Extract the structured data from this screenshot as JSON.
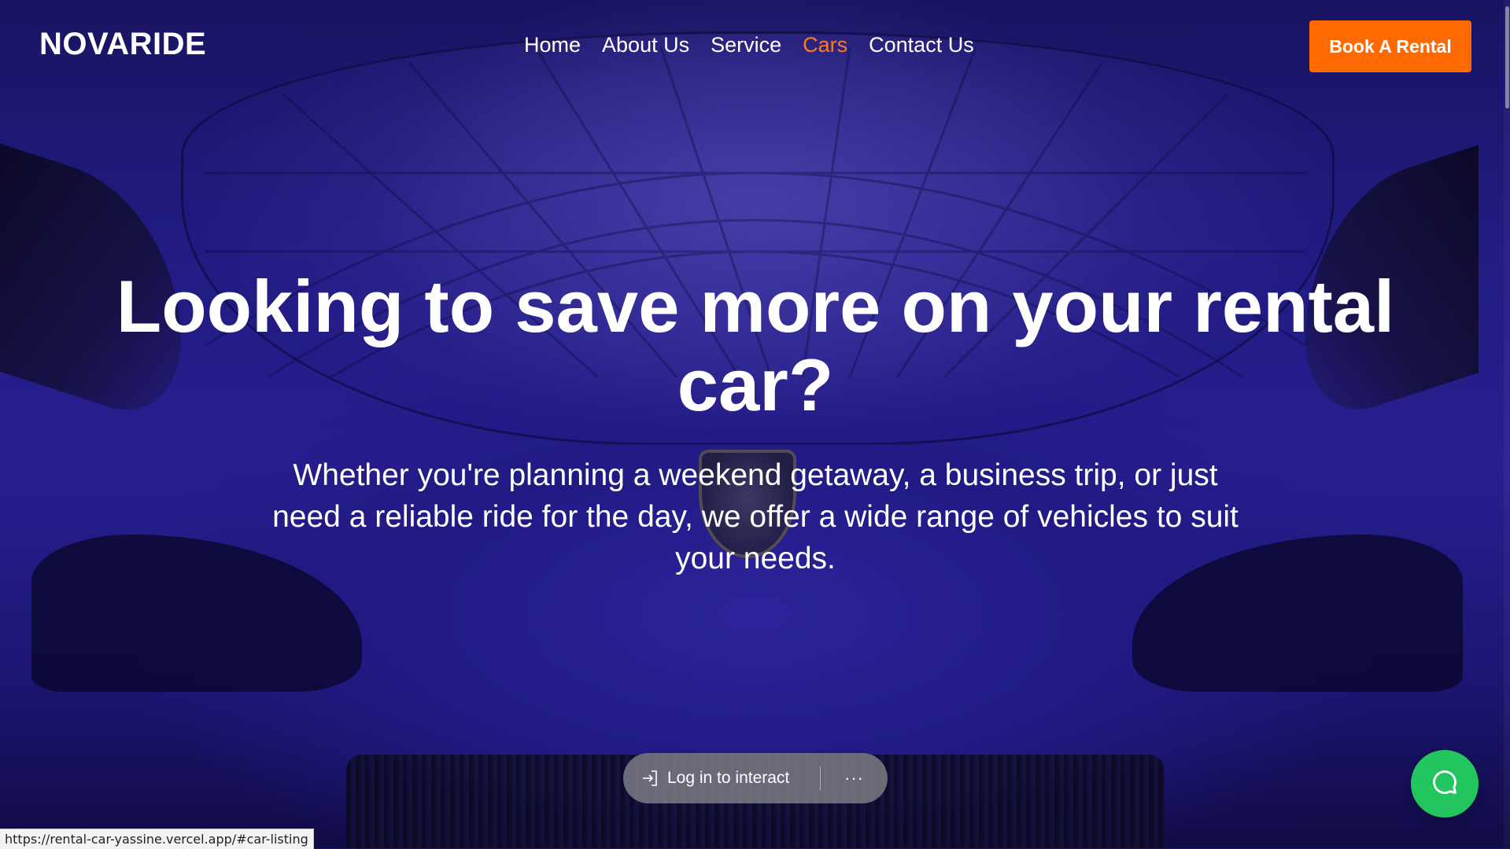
{
  "header": {
    "logo": "NOVARIDE",
    "nav": [
      {
        "label": "Home",
        "active": false
      },
      {
        "label": "About Us",
        "active": false
      },
      {
        "label": "Service",
        "active": false
      },
      {
        "label": "Cars",
        "active": true
      },
      {
        "label": "Contact Us",
        "active": false
      }
    ],
    "cta_label": "Book A Rental"
  },
  "hero": {
    "headline": "Looking to save more on your rental car?",
    "subtext": "Whether you're planning a weekend getaway, a business trip, or just need a reliable ride for the day, we offer a wide range of vehicles to suit your needs.",
    "background_icon": "car-front-image"
  },
  "login_pill": {
    "label": "Log in to interact",
    "icon": "login-icon",
    "more_label": "···"
  },
  "chat": {
    "icon": "chat-bubble-icon"
  },
  "status_bar": {
    "url": "https://rental-car-yassine.vercel.app/#car-listing"
  },
  "colors": {
    "accent": "#ff6a00",
    "active_nav": "#ff7a1a",
    "chat": "#22c55e",
    "hero_tint": "#2b24a6"
  }
}
